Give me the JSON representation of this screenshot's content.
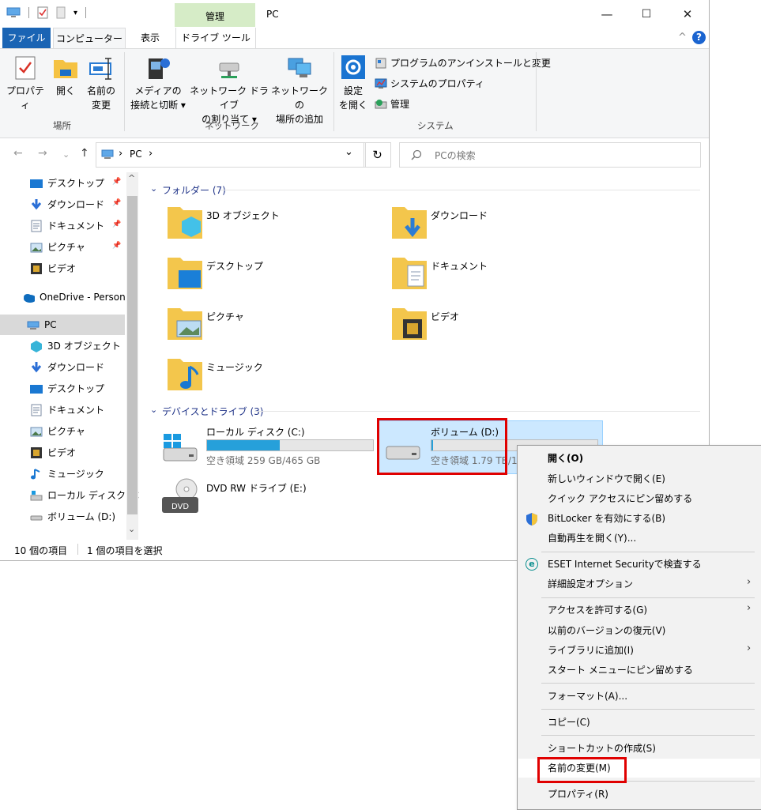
{
  "window": {
    "title": "PC",
    "context_tab": "管理",
    "minimize": "—",
    "maximize": "☐",
    "close": "✕"
  },
  "tabs": {
    "file": "ファイル",
    "computer": "コンピューター",
    "view": "表示",
    "drive_tools": "ドライブ ツール",
    "collapse": "^",
    "help": "?"
  },
  "ribbon": {
    "properties": "プロパティ",
    "open": "開く",
    "rename_l1": "名前の",
    "rename_l2": "変更",
    "media_l1": "メディアの",
    "media_l2": "接続と切断 ▾",
    "netdrive_l1": "ネットワーク ドライブ",
    "netdrive_l2": "の割り当て ▾",
    "netloc_l1": "ネットワークの",
    "netloc_l2": "場所の追加",
    "settings_l1": "設定",
    "settings_l2": "を開く",
    "uninstall": "プログラムのアンインストールと変更",
    "sysprops": "システムのプロパティ",
    "manage": "管理",
    "group_location": "場所",
    "group_network": "ネットワーク",
    "group_system": "システム"
  },
  "address": {
    "path_sep1": "›",
    "path": "PC",
    "path_sep2": "›",
    "dropdown": "⌄",
    "refresh": "↻",
    "search_placeholder": "PCの検索",
    "back": "←",
    "forward": "→",
    "recent": "⌄",
    "up": "↑"
  },
  "nav": {
    "quick": [
      {
        "label": "デスクトップ",
        "pin": "📌"
      },
      {
        "label": "ダウンロード",
        "pin": "📌"
      },
      {
        "label": "ドキュメント",
        "pin": "📌"
      },
      {
        "label": "ピクチャ",
        "pin": "📌"
      },
      {
        "label": "ビデオ",
        "pin": ""
      }
    ],
    "onedrive": "OneDrive - Person",
    "pc": "PC",
    "pc_items": [
      "3D オブジェクト",
      "ダウンロード",
      "デスクトップ",
      "ドキュメント",
      "ピクチャ",
      "ビデオ",
      "ミュージック",
      "ローカル ディスク (C",
      "ボリューム (D:)"
    ],
    "scroll_up": "^",
    "scroll_down": "⌄"
  },
  "content": {
    "folders_header": "フォルダー (7)",
    "folders": [
      "3D オブジェクト",
      "ダウンロード",
      "デスクトップ",
      "ドキュメント",
      "ピクチャ",
      "ビデオ",
      "ミュージック"
    ],
    "devices_header": "デバイスとドライブ (3)",
    "drive_c": {
      "name": "ローカル ディスク (C:)",
      "free": "空き領域 259 GB/465 GB",
      "used_fraction": 0.44
    },
    "drive_d": {
      "name": "ボリューム (D:)",
      "free": "空き領域 1.79 TB/1",
      "used_fraction": 0.01
    },
    "drive_e": {
      "name": "DVD RW ドライブ (E:)",
      "badge": "DVD"
    }
  },
  "status": {
    "count": "10 個の項目",
    "selected": "1 個の項目を選択"
  },
  "menu": {
    "items": [
      "開く(O)",
      "新しいウィンドウで開く(E)",
      "クイック アクセスにピン留めする",
      "BitLocker を有効にする(B)",
      "自動再生を開く(Y)...",
      "ESET Internet Securityで検査する",
      "詳細設定オプション",
      "アクセスを許可する(G)",
      "以前のバージョンの復元(V)",
      "ライブラリに追加(I)",
      "スタート メニューにピン留めする",
      "フォーマット(A)...",
      "コピー(C)",
      "ショートカットの作成(S)",
      "名前の変更(M)",
      "プロパティ(R)"
    ],
    "submenu_arrow": "›",
    "eset_badge": "e"
  }
}
